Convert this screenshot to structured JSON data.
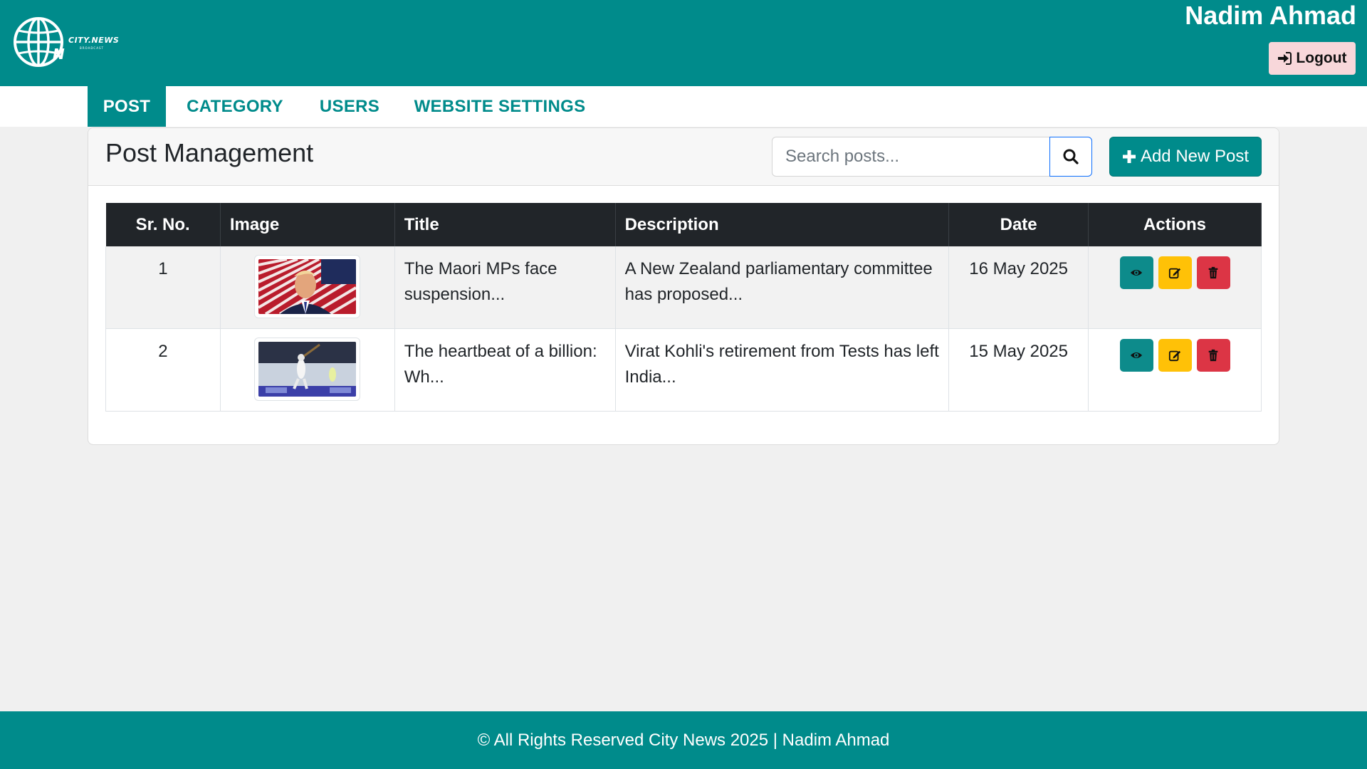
{
  "header": {
    "logo_text": "CITY.NEWS",
    "logo_subtext": "BROADCAST",
    "user_name": "Nadim Ahmad",
    "logout_label": "Logout"
  },
  "nav": {
    "items": [
      {
        "label": "POST",
        "active": true
      },
      {
        "label": "CATEGORY",
        "active": false
      },
      {
        "label": "USERS",
        "active": false
      },
      {
        "label": "WEBSITE SETTINGS",
        "active": false
      }
    ]
  },
  "main": {
    "title": "Post Management",
    "search_placeholder": "Search posts...",
    "add_button_label": "Add New Post",
    "table": {
      "columns": [
        "Sr. No.",
        "Image",
        "Title",
        "Description",
        "Date",
        "Actions"
      ],
      "rows": [
        {
          "sr": "1",
          "image_icon": "news-photo-flag",
          "title": "The Maori MPs face suspension...",
          "description": "A New Zealand parliamentary committee has proposed...",
          "date": "16 May 2025"
        },
        {
          "sr": "2",
          "image_icon": "news-photo-cricket",
          "title": "The heartbeat of a billion: Wh...",
          "description": "Virat Kohli's retirement from Tests has left India...",
          "date": "15 May 2025"
        }
      ]
    }
  },
  "footer": {
    "text": "© All Rights Reserved City News 2025 | Nadim Ahmad"
  },
  "colors": {
    "primary": "#008b8b",
    "dark": "#212529",
    "warning": "#ffc107",
    "danger": "#dc3545",
    "logout_bg": "#f8d7da"
  }
}
